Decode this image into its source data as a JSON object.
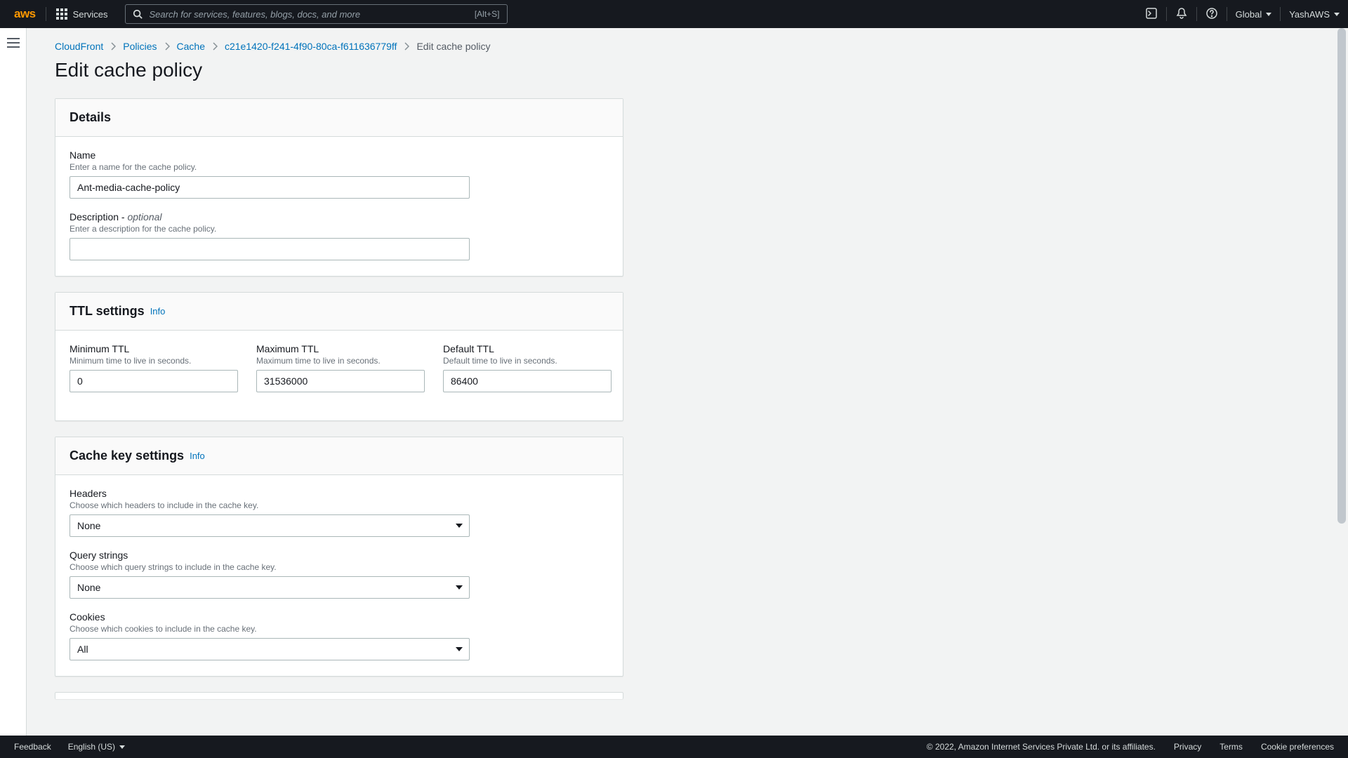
{
  "nav": {
    "logo_text": "aws",
    "services_label": "Services",
    "search_placeholder": "Search for services, features, blogs, docs, and more",
    "search_shortcut": "[Alt+S]",
    "region_label": "Global",
    "account_label": "YashAWS"
  },
  "breadcrumb": {
    "items": [
      "CloudFront",
      "Policies",
      "Cache",
      "c21e1420-f241-4f90-80ca-f611636779ff",
      "Edit cache policy"
    ]
  },
  "page": {
    "title": "Edit cache policy"
  },
  "details": {
    "heading": "Details",
    "name_label": "Name",
    "name_help": "Enter a name for the cache policy.",
    "name_value": "Ant-media-cache-policy",
    "description_label": "Description - ",
    "description_optional": "optional",
    "description_help": "Enter a description for the cache policy.",
    "description_value": ""
  },
  "ttl": {
    "heading": "TTL settings",
    "info": "Info",
    "min_label": "Minimum TTL",
    "min_help": "Minimum time to live in seconds.",
    "min_value": "0",
    "max_label": "Maximum TTL",
    "max_help": "Maximum time to live in seconds.",
    "max_value": "31536000",
    "default_label": "Default TTL",
    "default_help": "Default time to live in seconds.",
    "default_value": "86400"
  },
  "cachekey": {
    "heading": "Cache key settings",
    "info": "Info",
    "headers_label": "Headers",
    "headers_help": "Choose which headers to include in the cache key.",
    "headers_value": "None",
    "query_label": "Query strings",
    "query_help": "Choose which query strings to include in the cache key.",
    "query_value": "None",
    "cookies_label": "Cookies",
    "cookies_help": "Choose which cookies to include in the cache key.",
    "cookies_value": "All"
  },
  "footer": {
    "feedback": "Feedback",
    "language": "English (US)",
    "copyright": "© 2022, Amazon Internet Services Private Ltd. or its affiliates.",
    "privacy": "Privacy",
    "terms": "Terms",
    "cookies": "Cookie preferences"
  }
}
